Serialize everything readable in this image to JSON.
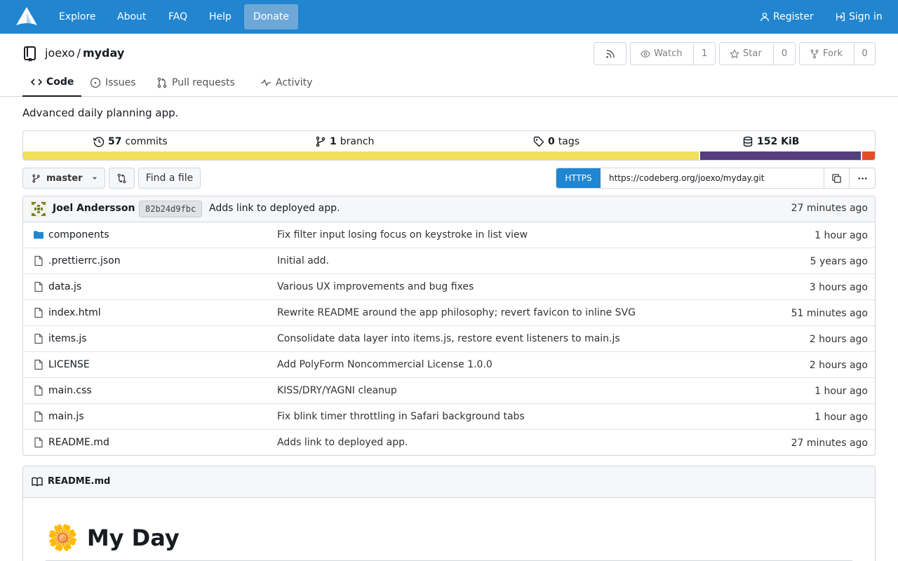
{
  "navbar": {
    "items": [
      "Explore",
      "About",
      "FAQ",
      "Help"
    ],
    "donate": "Donate",
    "register": "Register",
    "signin": "Sign in"
  },
  "repo": {
    "owner": "joexo",
    "separator": "/",
    "name": "myday",
    "watch_label": "Watch",
    "watch_count": "1",
    "star_label": "Star",
    "star_count": "0",
    "fork_label": "Fork",
    "fork_count": "0"
  },
  "tabs": [
    {
      "label": "Code",
      "icon": "code-icon",
      "active": true
    },
    {
      "label": "Issues",
      "icon": "issue-icon",
      "active": false
    },
    {
      "label": "Pull requests",
      "icon": "pull-request-icon",
      "active": false
    },
    {
      "label": "Activity",
      "icon": "pulse-icon",
      "active": false
    }
  ],
  "description": "Advanced daily planning app.",
  "stats": {
    "commits_count": "57",
    "commits_label": "commits",
    "branch_count": "1",
    "branch_label": "branch",
    "tags_count": "0",
    "tags_label": "tags",
    "size_value": "152 KiB"
  },
  "languages": [
    {
      "share": 0.795,
      "color": "#f1e05a"
    },
    {
      "share": 0.19,
      "color": "#563d7c"
    },
    {
      "share": 0.015,
      "color": "#e34c26"
    }
  ],
  "toolbar": {
    "branch": "master",
    "find_file": "Find a file",
    "clone_protocol": "HTTPS",
    "clone_url": "https://codeberg.org/joexo/myday.git"
  },
  "latest_commit": {
    "author": "Joel Andersson",
    "sha": "82b24d9fbc",
    "message": "Adds link to deployed app.",
    "time": "27 minutes ago"
  },
  "files": [
    {
      "name": "components",
      "type": "folder",
      "message": "Fix filter input losing focus on keystroke in list view",
      "time": "1 hour ago"
    },
    {
      "name": ".prettierrc.json",
      "type": "file",
      "message": "Initial add.",
      "time": "5 years ago"
    },
    {
      "name": "data.js",
      "type": "file",
      "message": "Various UX improvements and bug fixes",
      "time": "3 hours ago"
    },
    {
      "name": "index.html",
      "type": "file",
      "message": "Rewrite README around the app philosophy; revert favicon to inline SVG",
      "time": "51 minutes ago"
    },
    {
      "name": "items.js",
      "type": "file",
      "message": "Consolidate data layer into items.js, restore event listeners to main.js",
      "time": "2 hours ago"
    },
    {
      "name": "LICENSE",
      "type": "file",
      "message": "Add PolyForm Noncommercial License 1.0.0",
      "time": "2 hours ago"
    },
    {
      "name": "main.css",
      "type": "file",
      "message": "KISS/DRY/YAGNI cleanup",
      "time": "1 hour ago"
    },
    {
      "name": "main.js",
      "type": "file",
      "message": "Fix blink timer throttling in Safari background tabs",
      "time": "1 hour ago"
    },
    {
      "name": "README.md",
      "type": "file",
      "message": "Adds link to deployed app.",
      "time": "27 minutes ago"
    }
  ],
  "readme": {
    "filename": "README.md",
    "heading_emoji": "🌼",
    "heading": "My Day"
  },
  "colors": {
    "brand": "#2185d0",
    "folder": "#2185d0"
  }
}
